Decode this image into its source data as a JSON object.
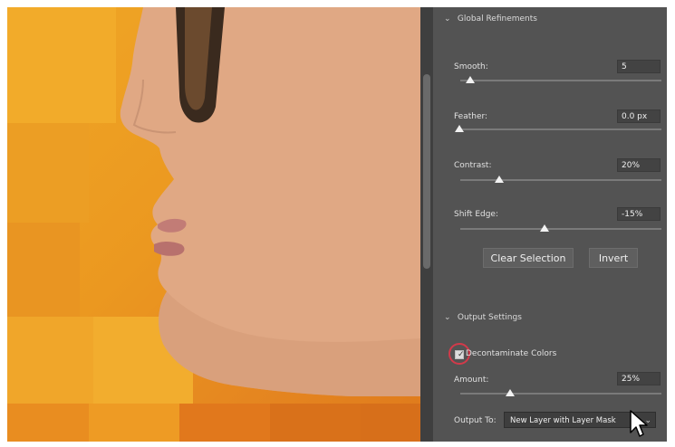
{
  "panel": {
    "global_refinements": {
      "title": "Global Refinements",
      "sliders": [
        {
          "label": "Smooth:",
          "value": "5",
          "level": 0.05
        },
        {
          "label": "Feather:",
          "value": "0.0 px",
          "level": 0.0
        },
        {
          "label": "Contrast:",
          "value": "20%",
          "level": 0.2
        },
        {
          "label": "Shift Edge:",
          "value": "-15%",
          "level": 0.42
        }
      ],
      "buttons": {
        "clear_selection": "Clear Selection",
        "invert": "Invert"
      }
    },
    "output_settings": {
      "title": "Output Settings",
      "decontaminate_label": "Decontaminate Colors",
      "decontaminate_checked": true,
      "amount": {
        "label": "Amount:",
        "value": "25%",
        "level": 0.25
      },
      "output_to_label": "Output To:",
      "output_to_value": "New Layer with Layer Mask"
    }
  },
  "icons": {
    "section_chevron": "chevron-down-icon",
    "select_caret": "chevron-down-icon",
    "cursor": "arrow-cursor-icon"
  },
  "colors": {
    "panel_bg": "#535353",
    "highlight_circle": "#d23a4a",
    "canvas_orange": "#eb9820"
  }
}
